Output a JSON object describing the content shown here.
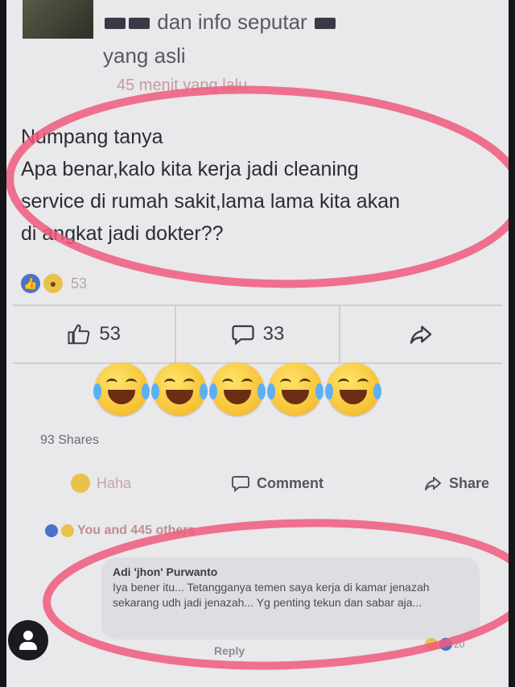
{
  "header": {
    "group_name_line1": "dan info seputar",
    "group_name_line2": "yang asli",
    "timestamp": "45 menit yang lalu"
  },
  "post": {
    "lines": [
      "Numpang tanya",
      "Apa benar,kalo kita kerja jadi cleaning",
      "service di rumah sakit,lama lama kita akan",
      "di angkat jadi dokter??"
    ],
    "reaction_count": "53"
  },
  "action_bar": {
    "like_count": "53",
    "comment_count": "33"
  },
  "emoji_reactions": [
    "laughing-crying",
    "laughing-crying",
    "laughing-crying",
    "laughing-crying",
    "laughing-crying"
  ],
  "shares": "93 Shares",
  "bottom_actions": {
    "haha": "Haha",
    "comment": "Comment",
    "share": "Share"
  },
  "reactions_summary": "You and 445 others",
  "comment": {
    "author": "Adi 'jhon' Purwanto",
    "text": "Iya bener itu... Tetangganya temen saya kerja di kamar jenazah sekarang udh jadi jenazah... Yg penting tekun dan sabar aja...",
    "reply_label": "Reply",
    "reaction_count": "20"
  },
  "colors": {
    "highlight_ellipse": "#ee5a7c",
    "like_blue": "#4a73c8",
    "haha_yellow": "#e8c24a"
  }
}
